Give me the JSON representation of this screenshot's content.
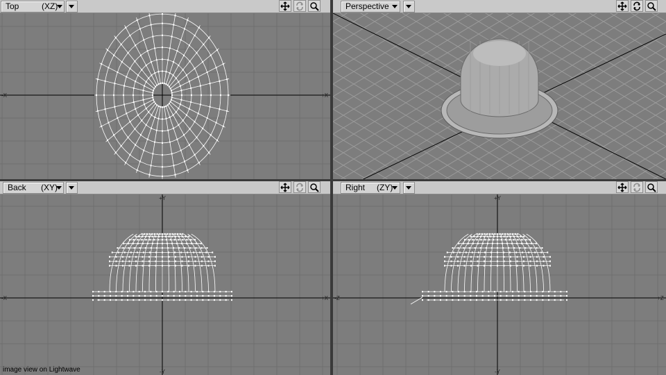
{
  "viewports": {
    "top": {
      "view": "Top",
      "axes": "(XZ)"
    },
    "perspective": {
      "view": "Perspective"
    },
    "back": {
      "view": "Back",
      "axes": "(XY)"
    },
    "right": {
      "view": "Right",
      "axes": "(ZY)"
    }
  },
  "toolbar_icons": [
    "move-view-icon",
    "rotate-view-icon",
    "zoom-view-icon"
  ],
  "axis_labels": {
    "y": "+Y",
    "neg_y": "-Y",
    "x": "+X",
    "neg_x": "-X",
    "z": "+Z",
    "neg_z": "-Z"
  },
  "caption": "image view on Lightwave",
  "colors": {
    "viewport_bg": "#7d7d7d",
    "grid": "#6e6e6e",
    "axis": "#000000",
    "wire": "#ffffff",
    "header": "#c9c9c9"
  }
}
